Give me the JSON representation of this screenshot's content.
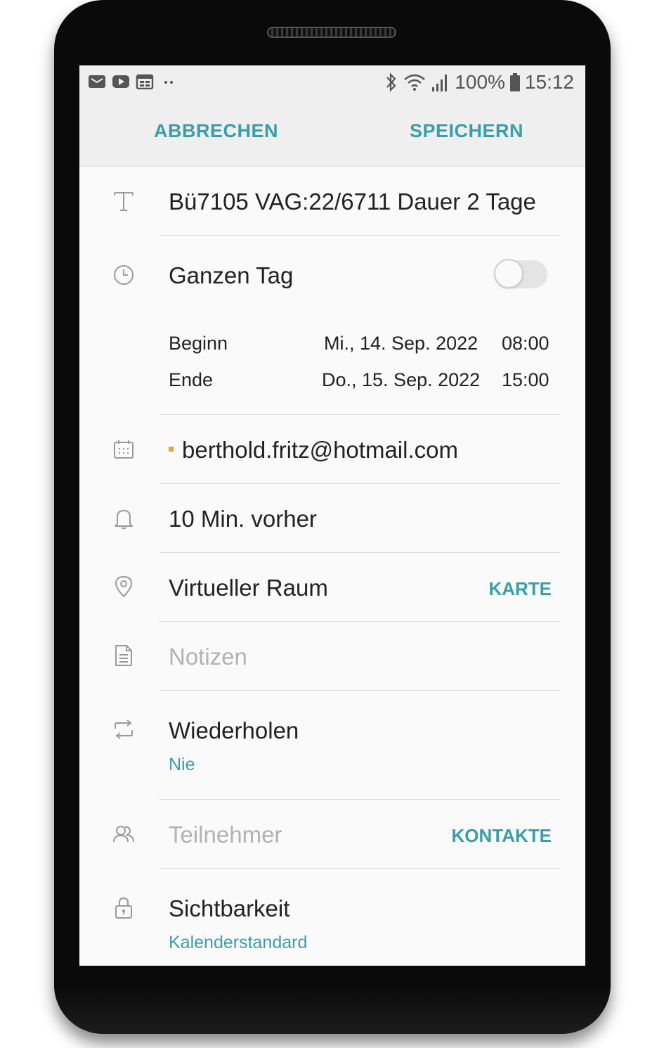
{
  "status_bar": {
    "battery": "100%",
    "time": "15:12",
    "left_icons": [
      "mail-icon",
      "youtube-icon",
      "calendar-icon",
      "more-notifications-icon"
    ],
    "right_icons": [
      "bluetooth-icon",
      "wifi-icon",
      "signal-icon",
      "battery-icon"
    ]
  },
  "action_bar": {
    "cancel_label": "ABBRECHEN",
    "save_label": "SPEICHERN"
  },
  "event": {
    "title": "Bü7105  VAG:22/6711 Dauer 2 Tage",
    "all_day_label": "Ganzen Tag",
    "all_day_enabled": false,
    "start_label": "Beginn",
    "start_date": "Mi., 14. Sep. 2022",
    "start_time": "08:00",
    "end_label": "Ende",
    "end_date": "Do., 15. Sep. 2022",
    "end_time": "15:00",
    "calendar_account": "berthold.fritz@hotmail.com",
    "calendar_color": "#f0a032",
    "reminder": "10 Min. vorher",
    "location": "Virtueller Raum",
    "map_label": "KARTE",
    "notes_placeholder": "Notizen",
    "repeat_label": "Wiederholen",
    "repeat_value": "Nie",
    "participants_placeholder": "Teilnehmer",
    "contacts_label": "KONTAKTE",
    "visibility_label": "Sichtbarkeit",
    "visibility_value": "Kalenderstandard"
  },
  "colors": {
    "accent": "#3a9ea8",
    "background": "#fafafa",
    "bar": "#efefef"
  }
}
